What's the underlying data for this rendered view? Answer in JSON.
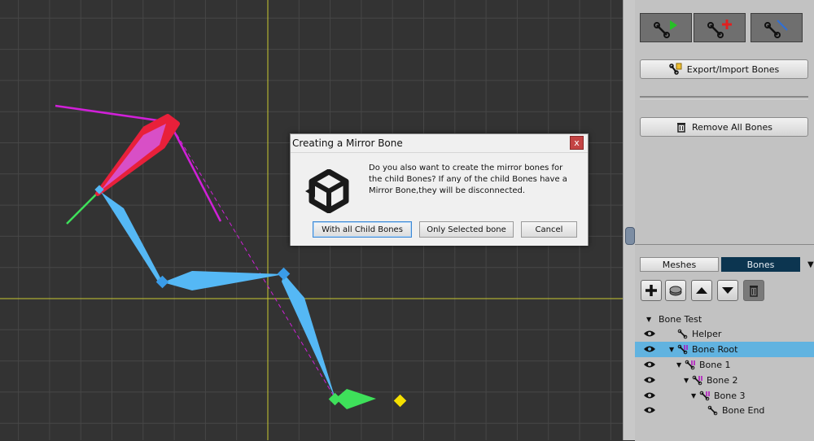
{
  "colors": {
    "canvas_bg": "#333333",
    "grid_line": "#474747",
    "axis_line": "#c8c832",
    "bone_blue": "#55b8f5",
    "bone_selected_fill": "#d84fc6",
    "bone_selected_outline": "#e8203a",
    "bone_green": "#3ee05a",
    "guide_magenta": "#d020d8",
    "joint_blue": "#3a9ce8",
    "marker_yellow": "#f5e000",
    "panel_bg": "#c2c2c2",
    "tab_active": "#0c3550",
    "row_selected": "#61b3e0"
  },
  "toolbar": {
    "icons": [
      "bone-select-icon",
      "bone-add-icon",
      "bone-link-icon"
    ]
  },
  "buttons": {
    "export_import": "Export/Import Bones",
    "remove_all": "Remove All Bones"
  },
  "tabs": {
    "meshes": "Meshes",
    "bones": "Bones",
    "active": "Bones"
  },
  "bone_tools": [
    "add-bone-icon",
    "bone-mirror-icon",
    "move-up-icon",
    "move-down-icon",
    "delete-bone-icon"
  ],
  "tree": {
    "root": "Bone Test",
    "items": [
      {
        "label": "Helper"
      },
      {
        "label": "Bone Root"
      },
      {
        "label": "Bone 1"
      },
      {
        "label": "Bone 2"
      },
      {
        "label": "Bone 3"
      },
      {
        "label": "Bone End"
      }
    ],
    "selected": "Bone Root"
  },
  "dialog": {
    "title": "Creating a Mirror Bone",
    "close": "x",
    "message": "Do you also want to create the mirror bones for the child Bones? If any of the child Bones have a Mirror Bone,they will be disconnected.",
    "buttons": {
      "all_children": "With all Child Bones",
      "selected_only": "Only Selected bone",
      "cancel": "Cancel"
    }
  }
}
